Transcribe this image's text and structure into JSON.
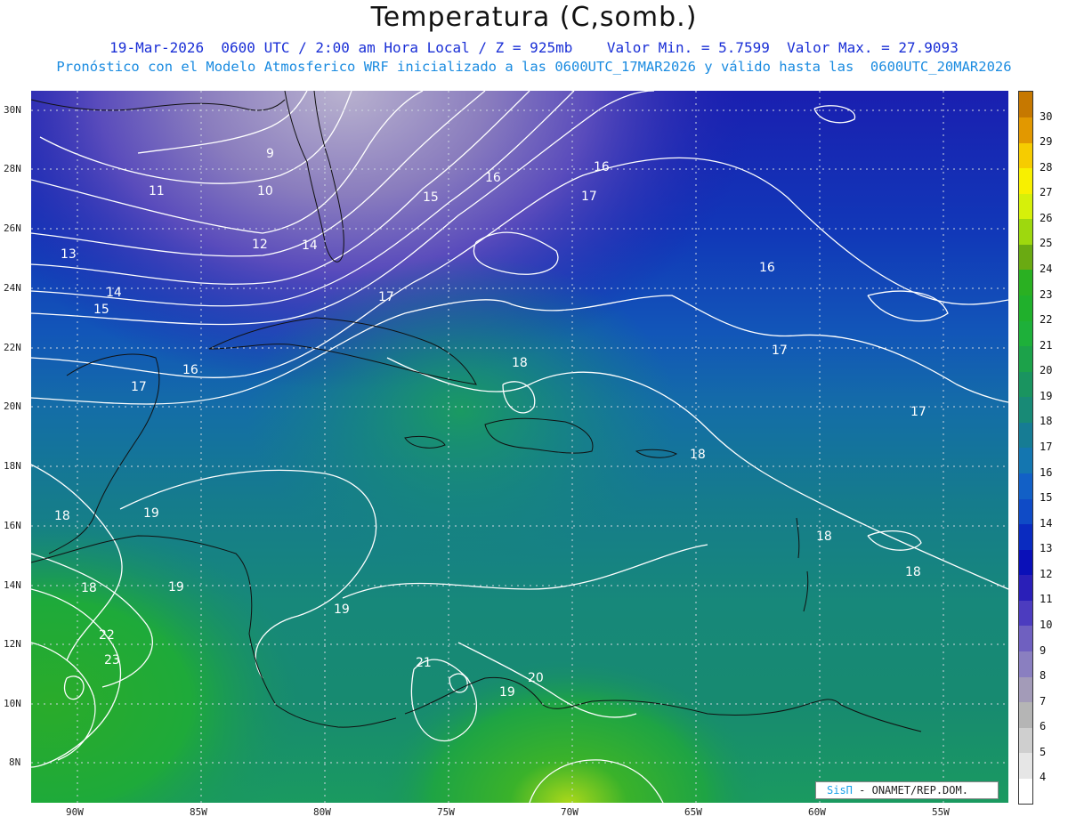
{
  "header": {
    "title": "Temperatura (C,somb.)",
    "subtitle_1": "19-Mar-2026  0600 UTC / 2:00 am Hora Local / Z = 925mb    Valor Min. = 5.7599  Valor Max. = 27.9093",
    "subtitle_2": "Pronóstico con el Modelo Atmosferico WRF inicializado a las 0600UTC_17MAR2026 y válido hasta las  0600UTC_20MAR2026"
  },
  "axes": {
    "lat_labels": [
      "30N",
      "28N",
      "26N",
      "24N",
      "22N",
      "20N",
      "18N",
      "16N",
      "14N",
      "12N",
      "10N",
      "8N"
    ],
    "lon_labels": [
      "90W",
      "85W",
      "80W",
      "75W",
      "70W",
      "65W",
      "60W",
      "55W"
    ],
    "lat_range": [
      6.7,
      30.7
    ],
    "lon_range": [
      -91.9,
      -52.5
    ]
  },
  "colorbar": {
    "levels": [
      "4",
      "5",
      "6",
      "7",
      "8",
      "9",
      "10",
      "11",
      "12",
      "13",
      "14",
      "15",
      "16",
      "17",
      "18",
      "19",
      "20",
      "21",
      "22",
      "23",
      "24",
      "25",
      "26",
      "27",
      "28",
      "29",
      "30"
    ],
    "colors": [
      "#ffffff",
      "#e6e6e6",
      "#cfcfcf",
      "#b5b5b5",
      "#a39bb8",
      "#8a7fc0",
      "#6f60c0",
      "#4c3cbf",
      "#2a1fb8",
      "#0a10b8",
      "#0a2bc0",
      "#0f4bc6",
      "#1260c6",
      "#1476b0",
      "#167c94",
      "#188a76",
      "#1a9460",
      "#1ca24a",
      "#1eb03a",
      "#20b02c",
      "#2ab022",
      "#6aaa12",
      "#9ed80e",
      "#d6f00a",
      "#f8f000",
      "#f6cc00",
      "#e29800",
      "#c67800"
    ]
  },
  "map_contour_labels": [
    "9",
    "10",
    "11",
    "12",
    "13",
    "14",
    "14",
    "15",
    "15",
    "16",
    "16",
    "16",
    "16",
    "17",
    "17",
    "17",
    "17",
    "17",
    "18",
    "18",
    "18",
    "18",
    "18",
    "18",
    "19",
    "19",
    "19",
    "19",
    "20",
    "21",
    "22",
    "23"
  ],
  "credit": {
    "logo": "SisΠ",
    "text": "- ONAMET/REP.DOM."
  }
}
